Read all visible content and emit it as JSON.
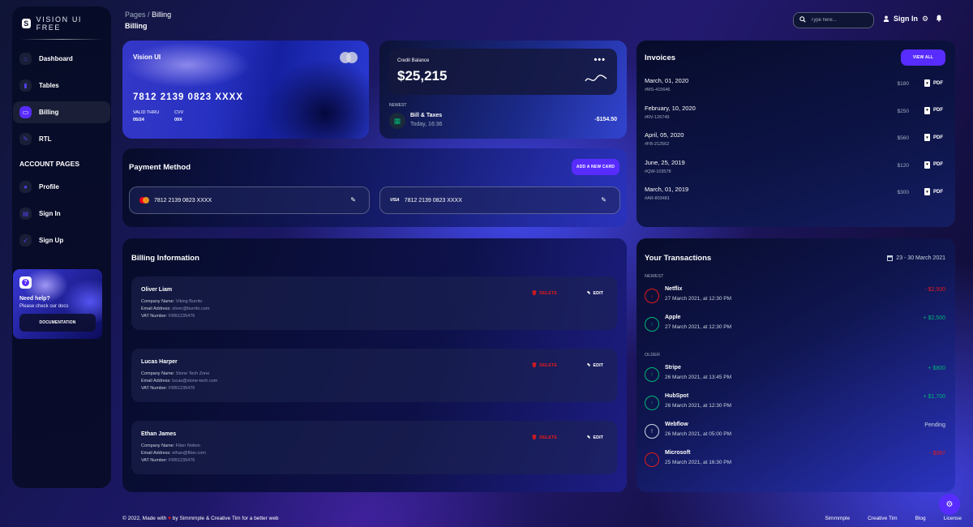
{
  "app": {
    "brand": "VISION UI FREE",
    "brand_logo_letter": "S"
  },
  "sidebar": {
    "items": [
      {
        "label": "Dashboard",
        "icon": "home-icon",
        "active": false
      },
      {
        "label": "Tables",
        "icon": "chart-bar-icon",
        "active": false
      },
      {
        "label": "Billing",
        "icon": "credit-card-icon",
        "active": true
      },
      {
        "label": "RTL",
        "icon": "wrench-icon",
        "active": false
      }
    ],
    "section_title": "ACCOUNT PAGES",
    "account_items": [
      {
        "label": "Profile",
        "icon": "person-icon"
      },
      {
        "label": "Sign In",
        "icon": "document-icon"
      },
      {
        "label": "Sign Up",
        "icon": "rocket-icon"
      }
    ],
    "help": {
      "icon_glyph": "?",
      "title": "Need help?",
      "subtitle": "Please check our docs",
      "button": "DOCUMENTATION"
    }
  },
  "header": {
    "breadcrumb_root": "Pages",
    "breadcrumb_sep": "/",
    "breadcrumb_current": "Billing",
    "title": "Billing",
    "search_placeholder": "Type here...",
    "signin_label": "Sign In"
  },
  "credit_card": {
    "title": "Vision UI",
    "number": "7812 2139 0823 XXXX",
    "valid_label": "VALID THRU",
    "valid_value": "05/24",
    "cvv_label": "CVV",
    "cvv_value": "09X"
  },
  "balance": {
    "label": "Credit Balance",
    "value": "$25,215",
    "menu_glyph": "•••",
    "newest_label": "NEWEST",
    "tx_name": "Bill & Taxes",
    "tx_date": "Today, 16:36",
    "tx_amount": "-$154.50"
  },
  "payment": {
    "title": "Payment Method",
    "add_button": "ADD A NEW CARD",
    "cards": [
      {
        "brand": "mastercard",
        "number": "7812 2139 0823 XXXX"
      },
      {
        "brand": "VISA",
        "number": "7812 2139 0823 XXXX"
      }
    ]
  },
  "invoices": {
    "title": "Invoices",
    "view_all": "VIEW ALL",
    "pdf_label": "PDF",
    "items": [
      {
        "date": "March, 01, 2020",
        "id": "#MS-415646",
        "amount": "$180"
      },
      {
        "date": "February, 10, 2020",
        "id": "#RV-126749",
        "amount": "$250"
      },
      {
        "date": "April, 05, 2020",
        "id": "#FB-212562",
        "amount": "$560"
      },
      {
        "date": "June, 25, 2019",
        "id": "#QW-103578",
        "amount": "$120"
      },
      {
        "date": "March, 01, 2019",
        "id": "#AR-803481",
        "amount": "$300"
      }
    ]
  },
  "billing": {
    "title": "Billing Information",
    "company_label": "Company Name: ",
    "email_label": "Email Address: ",
    "vat_label": "VAT Number: ",
    "delete_label": "DELETE",
    "edit_label": "EDIT",
    "people": [
      {
        "name": "Oliver Liam",
        "company": "Viking Burrito",
        "email": "oliver@burrito.com",
        "vat": "FRB1235476"
      },
      {
        "name": "Lucas Harper",
        "company": "Stone Tech Zone",
        "email": "lucas@stone-tech.com",
        "vat": "FRB1235476"
      },
      {
        "name": "Ethan James",
        "company": "Fiber Notion",
        "email": "ethan@fiber.com",
        "vat": "FRB1235476"
      }
    ]
  },
  "transactions": {
    "title": "Your Transactions",
    "range": "23 - 30 March 2021",
    "newest_label": "NEWEST",
    "older_label": "OLDER",
    "colors": {
      "negative": "#e31a1a",
      "positive": "#01b574",
      "pending": "#cbd5e0"
    },
    "newest": [
      {
        "name": "Netflix",
        "date": "27 March 2021, at 12:30 PM",
        "amount": "- $2,500",
        "type": "negative"
      },
      {
        "name": "Apple",
        "date": "27 March 2021, at 12:30 PM",
        "amount": "+ $2,500",
        "type": "positive"
      }
    ],
    "older": [
      {
        "name": "Stripe",
        "date": "26 March 2021, at 13:45 PM",
        "amount": "+ $800",
        "type": "positive"
      },
      {
        "name": "HubSpot",
        "date": "26 March 2021, at 12:30 PM",
        "amount": "+ $1,700",
        "type": "positive"
      },
      {
        "name": "Webflow",
        "date": "26 March 2021, at 05:00 PM",
        "amount": "Pending",
        "type": "pending"
      },
      {
        "name": "Microsoft",
        "date": "25 March 2021, at 16:30 PM",
        "amount": "- $987",
        "type": "negative"
      }
    ]
  },
  "footer": {
    "copyright_pre": "© 2022, Made with",
    "copyright_post": "by Simmmple & Creative Tim for a better web",
    "links": [
      "Simmmple",
      "Creative Tim",
      "Blog",
      "License"
    ]
  },
  "theme": {
    "accent": "#582cff"
  }
}
